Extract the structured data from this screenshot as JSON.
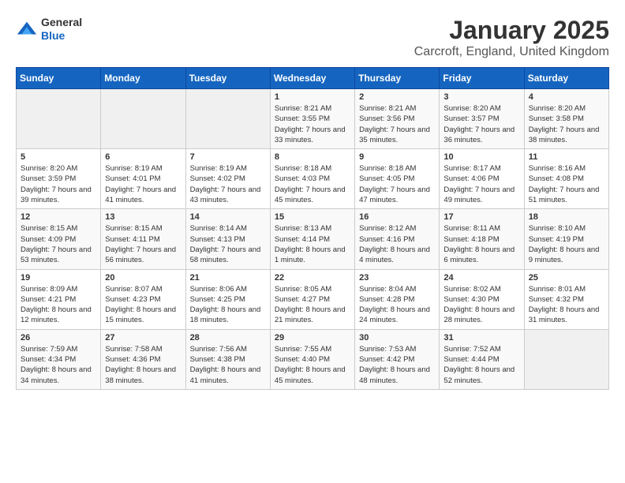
{
  "header": {
    "logo_general": "General",
    "logo_blue": "Blue",
    "month_year": "January 2025",
    "location": "Carcroft, England, United Kingdom"
  },
  "days_of_week": [
    "Sunday",
    "Monday",
    "Tuesday",
    "Wednesday",
    "Thursday",
    "Friday",
    "Saturday"
  ],
  "weeks": [
    [
      {
        "day": null
      },
      {
        "day": null
      },
      {
        "day": null
      },
      {
        "day": 1,
        "sunrise": "Sunrise: 8:21 AM",
        "sunset": "Sunset: 3:55 PM",
        "daylight": "Daylight: 7 hours and 33 minutes."
      },
      {
        "day": 2,
        "sunrise": "Sunrise: 8:21 AM",
        "sunset": "Sunset: 3:56 PM",
        "daylight": "Daylight: 7 hours and 35 minutes."
      },
      {
        "day": 3,
        "sunrise": "Sunrise: 8:20 AM",
        "sunset": "Sunset: 3:57 PM",
        "daylight": "Daylight: 7 hours and 36 minutes."
      },
      {
        "day": 4,
        "sunrise": "Sunrise: 8:20 AM",
        "sunset": "Sunset: 3:58 PM",
        "daylight": "Daylight: 7 hours and 38 minutes."
      }
    ],
    [
      {
        "day": 5,
        "sunrise": "Sunrise: 8:20 AM",
        "sunset": "Sunset: 3:59 PM",
        "daylight": "Daylight: 7 hours and 39 minutes."
      },
      {
        "day": 6,
        "sunrise": "Sunrise: 8:19 AM",
        "sunset": "Sunset: 4:01 PM",
        "daylight": "Daylight: 7 hours and 41 minutes."
      },
      {
        "day": 7,
        "sunrise": "Sunrise: 8:19 AM",
        "sunset": "Sunset: 4:02 PM",
        "daylight": "Daylight: 7 hours and 43 minutes."
      },
      {
        "day": 8,
        "sunrise": "Sunrise: 8:18 AM",
        "sunset": "Sunset: 4:03 PM",
        "daylight": "Daylight: 7 hours and 45 minutes."
      },
      {
        "day": 9,
        "sunrise": "Sunrise: 8:18 AM",
        "sunset": "Sunset: 4:05 PM",
        "daylight": "Daylight: 7 hours and 47 minutes."
      },
      {
        "day": 10,
        "sunrise": "Sunrise: 8:17 AM",
        "sunset": "Sunset: 4:06 PM",
        "daylight": "Daylight: 7 hours and 49 minutes."
      },
      {
        "day": 11,
        "sunrise": "Sunrise: 8:16 AM",
        "sunset": "Sunset: 4:08 PM",
        "daylight": "Daylight: 7 hours and 51 minutes."
      }
    ],
    [
      {
        "day": 12,
        "sunrise": "Sunrise: 8:15 AM",
        "sunset": "Sunset: 4:09 PM",
        "daylight": "Daylight: 7 hours and 53 minutes."
      },
      {
        "day": 13,
        "sunrise": "Sunrise: 8:15 AM",
        "sunset": "Sunset: 4:11 PM",
        "daylight": "Daylight: 7 hours and 56 minutes."
      },
      {
        "day": 14,
        "sunrise": "Sunrise: 8:14 AM",
        "sunset": "Sunset: 4:13 PM",
        "daylight": "Daylight: 7 hours and 58 minutes."
      },
      {
        "day": 15,
        "sunrise": "Sunrise: 8:13 AM",
        "sunset": "Sunset: 4:14 PM",
        "daylight": "Daylight: 8 hours and 1 minute."
      },
      {
        "day": 16,
        "sunrise": "Sunrise: 8:12 AM",
        "sunset": "Sunset: 4:16 PM",
        "daylight": "Daylight: 8 hours and 4 minutes."
      },
      {
        "day": 17,
        "sunrise": "Sunrise: 8:11 AM",
        "sunset": "Sunset: 4:18 PM",
        "daylight": "Daylight: 8 hours and 6 minutes."
      },
      {
        "day": 18,
        "sunrise": "Sunrise: 8:10 AM",
        "sunset": "Sunset: 4:19 PM",
        "daylight": "Daylight: 8 hours and 9 minutes."
      }
    ],
    [
      {
        "day": 19,
        "sunrise": "Sunrise: 8:09 AM",
        "sunset": "Sunset: 4:21 PM",
        "daylight": "Daylight: 8 hours and 12 minutes."
      },
      {
        "day": 20,
        "sunrise": "Sunrise: 8:07 AM",
        "sunset": "Sunset: 4:23 PM",
        "daylight": "Daylight: 8 hours and 15 minutes."
      },
      {
        "day": 21,
        "sunrise": "Sunrise: 8:06 AM",
        "sunset": "Sunset: 4:25 PM",
        "daylight": "Daylight: 8 hours and 18 minutes."
      },
      {
        "day": 22,
        "sunrise": "Sunrise: 8:05 AM",
        "sunset": "Sunset: 4:27 PM",
        "daylight": "Daylight: 8 hours and 21 minutes."
      },
      {
        "day": 23,
        "sunrise": "Sunrise: 8:04 AM",
        "sunset": "Sunset: 4:28 PM",
        "daylight": "Daylight: 8 hours and 24 minutes."
      },
      {
        "day": 24,
        "sunrise": "Sunrise: 8:02 AM",
        "sunset": "Sunset: 4:30 PM",
        "daylight": "Daylight: 8 hours and 28 minutes."
      },
      {
        "day": 25,
        "sunrise": "Sunrise: 8:01 AM",
        "sunset": "Sunset: 4:32 PM",
        "daylight": "Daylight: 8 hours and 31 minutes."
      }
    ],
    [
      {
        "day": 26,
        "sunrise": "Sunrise: 7:59 AM",
        "sunset": "Sunset: 4:34 PM",
        "daylight": "Daylight: 8 hours and 34 minutes."
      },
      {
        "day": 27,
        "sunrise": "Sunrise: 7:58 AM",
        "sunset": "Sunset: 4:36 PM",
        "daylight": "Daylight: 8 hours and 38 minutes."
      },
      {
        "day": 28,
        "sunrise": "Sunrise: 7:56 AM",
        "sunset": "Sunset: 4:38 PM",
        "daylight": "Daylight: 8 hours and 41 minutes."
      },
      {
        "day": 29,
        "sunrise": "Sunrise: 7:55 AM",
        "sunset": "Sunset: 4:40 PM",
        "daylight": "Daylight: 8 hours and 45 minutes."
      },
      {
        "day": 30,
        "sunrise": "Sunrise: 7:53 AM",
        "sunset": "Sunset: 4:42 PM",
        "daylight": "Daylight: 8 hours and 48 minutes."
      },
      {
        "day": 31,
        "sunrise": "Sunrise: 7:52 AM",
        "sunset": "Sunset: 4:44 PM",
        "daylight": "Daylight: 8 hours and 52 minutes."
      },
      {
        "day": null
      }
    ]
  ]
}
